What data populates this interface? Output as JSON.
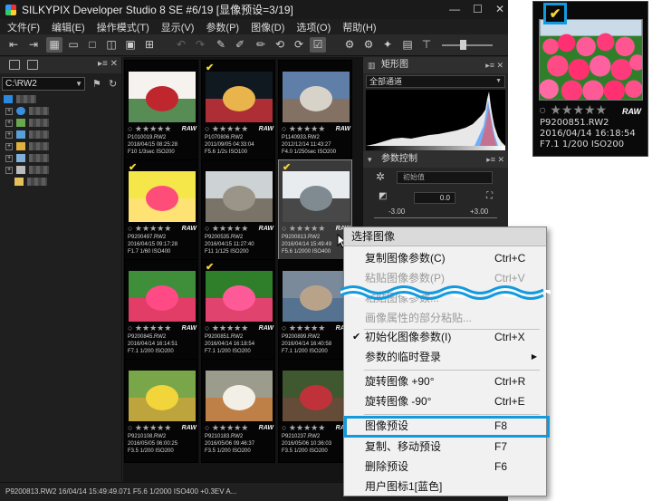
{
  "window": {
    "title": "SILKYPIX Developer Studio 8 SE   #6/19 [显像预设=3/19]",
    "controls": [
      "—",
      "☐",
      "✕"
    ]
  },
  "menubar": {
    "items": [
      "文件(F)",
      "编辑(E)",
      "操作模式(T)",
      "显示(V)",
      "参数(P)",
      "图像(D)",
      "选项(O)",
      "帮助(H)"
    ]
  },
  "leftpane": {
    "path": "C:\\RW2"
  },
  "thumbnails": [
    {
      "file": "P1010019.RW2",
      "date": "2018/04/15 08:25:28",
      "exif": "F10 1/3sec ISO200",
      "checked": false
    },
    {
      "file": "P1070806.RW2",
      "date": "2011/09/05 04:33:04",
      "exif": "F5.6 1/2s ISO100",
      "checked": true
    },
    {
      "file": "P1140933.RW2",
      "date": "2012/12/14 11:43:27",
      "exif": "F4.0 1/250sec ISO200",
      "checked": false
    },
    {
      "file": "P9200497.RW2",
      "date": "2016/04/15 09:17:28",
      "exif": "F1.7 1/60 ISO400",
      "checked": true
    },
    {
      "file": "P9200535.RW2",
      "date": "2016/04/15 11:27:40",
      "exif": "F11 1/125 ISO200",
      "checked": false
    },
    {
      "file": "P9200813.RW2",
      "date": "2016/04/14 15:49:49",
      "exif": "F5.6 1/2000 ISO400",
      "checked": true
    },
    {
      "file": "P9200845.RW2",
      "date": "2016/04/14 16:14:51",
      "exif": "F7.1 1/200 ISO200",
      "checked": false
    },
    {
      "file": "P9200851.RW2",
      "date": "2016/04/14 16:18:54",
      "exif": "F7.1 1/200 ISO200",
      "checked": true
    },
    {
      "file": "P9200899.RW2",
      "date": "2016/04/14 16:40:58",
      "exif": "F7.1 1/200 ISO200",
      "checked": false
    },
    {
      "file": "P9210108.RW2",
      "date": "2016/05/05 06:00:25",
      "exif": "F3.5 1/200 ISO200",
      "checked": false
    },
    {
      "file": "P9210183.RW2",
      "date": "2016/05/06 09:46:37",
      "exif": "F3.5 1/200 ISO200",
      "checked": false
    },
    {
      "file": "P9210237.RW2",
      "date": "2016/05/06 10:36:03",
      "exif": "F3.5 1/200 ISO200",
      "checked": false
    }
  ],
  "histogram_panel": {
    "title": "矩形图",
    "channel": "全部通道"
  },
  "control_panel": {
    "title": "参数控制",
    "preset": "初始值",
    "exposure_value": "0.0",
    "exposure_min": "-3.00",
    "exposure_max": "+3.00"
  },
  "statusbar": {
    "text": "P9200813.RW2 16/04/14 15:49:49.071 F5.6 1/2000 ISO400 +0.3EV A..."
  },
  "context_menu": {
    "header": "选择图像",
    "items": [
      {
        "label": "复制图像参数(C)",
        "shortcut": "Ctrl+C",
        "disabled": false
      },
      {
        "label": "粘贴图像参数(P)",
        "shortcut": "Ctrl+V",
        "disabled": true
      },
      {
        "label": "粘贴图像参数...",
        "shortcut": "",
        "disabled": true
      },
      {
        "label": "画像属性的部分粘贴...",
        "shortcut": "",
        "disabled": true
      },
      {
        "label": "初始化图像参数(I)",
        "shortcut": "Ctrl+X",
        "disabled": false,
        "checked": true
      },
      {
        "label": "参数的临时登录",
        "shortcut": "",
        "disabled": false,
        "submenu": true
      },
      {
        "label": "旋转图像 +90°",
        "shortcut": "Ctrl+R",
        "disabled": false
      },
      {
        "label": "旋转图像 -90°",
        "shortcut": "Ctrl+E",
        "disabled": false
      },
      {
        "label": "图像预设",
        "shortcut": "F8",
        "disabled": false,
        "highlighted": true
      },
      {
        "label": "复制、移动预设",
        "shortcut": "F7",
        "disabled": false
      },
      {
        "label": "删除预设",
        "shortcut": "F6",
        "disabled": false
      },
      {
        "label": "用户图标1[蓝色]",
        "shortcut": "",
        "disabled": false
      }
    ]
  },
  "callout": {
    "check_mark": "✔",
    "rating": "○ ★★★★★",
    "raw_badge": "RAW",
    "file": "P9200851.RW2",
    "date": "2016/04/14 16:18:54",
    "exif": "F7.1 1/200 ISO200"
  },
  "thumb_rating": "○ ★★★★★",
  "thumb_raw": "RAW",
  "accent_color": "#129adf",
  "check_color": "#f2d43b"
}
